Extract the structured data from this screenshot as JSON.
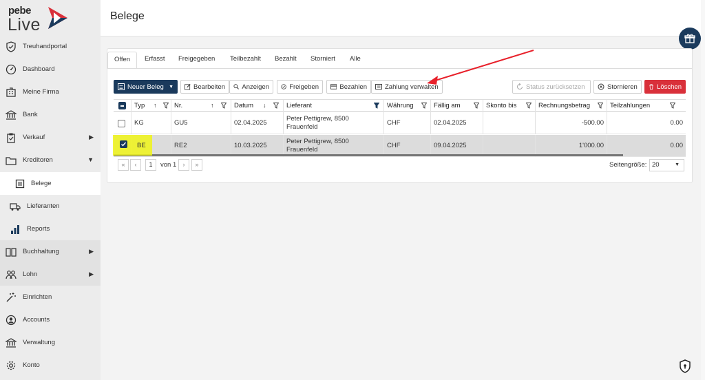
{
  "logo": {
    "brand_top": "pebe",
    "brand_bottom": "Live"
  },
  "sidebar": {
    "items": [
      {
        "label": "Treuhandportal",
        "icon": "shield-check-icon",
        "arrow": ""
      },
      {
        "label": "Dashboard",
        "icon": "gauge-icon",
        "arrow": ""
      },
      {
        "label": "Meine Firma",
        "icon": "building-icon",
        "arrow": ""
      },
      {
        "label": "Bank",
        "icon": "bank-icon",
        "arrow": ""
      },
      {
        "label": "Verkauf",
        "icon": "clipboard-check-icon",
        "arrow": "▶"
      },
      {
        "label": "Kreditoren",
        "icon": "folder-icon",
        "arrow": "▼"
      },
      {
        "label": "Belege",
        "icon": "receipt-icon",
        "arrow": ""
      },
      {
        "label": "Lieferanten",
        "icon": "truck-icon",
        "arrow": ""
      },
      {
        "label": "Reports",
        "icon": "bar-chart-icon",
        "arrow": ""
      },
      {
        "label": "Buchhaltung",
        "icon": "book-icon",
        "arrow": "▶"
      },
      {
        "label": "Lohn",
        "icon": "users-icon",
        "arrow": "▶"
      },
      {
        "label": "Einrichten",
        "icon": "magic-wand-icon",
        "arrow": ""
      },
      {
        "label": "Accounts",
        "icon": "user-circle-icon",
        "arrow": ""
      },
      {
        "label": "Verwaltung",
        "icon": "bank-icon",
        "arrow": ""
      },
      {
        "label": "Konto",
        "icon": "gear-icon",
        "arrow": ""
      }
    ]
  },
  "header": {
    "title": "Belege"
  },
  "tabs": [
    "Offen",
    "Erfasst",
    "Freigegeben",
    "Teilbezahlt",
    "Bezahlt",
    "Storniert",
    "Alle"
  ],
  "toolbar": {
    "new": "Neuer Beleg",
    "edit": "Bearbeiten",
    "show": "Anzeigen",
    "approve": "Freigeben",
    "pay": "Bezahlen",
    "manage_payment": "Zahlung verwalten",
    "reset_status": "Status zurücksetzen",
    "cancel": "Stornieren",
    "delete": "Löschen"
  },
  "table": {
    "columns": [
      "Typ",
      "Nr.",
      "Datum",
      "Lieferant",
      "Währung",
      "Fällig am",
      "Skonto bis",
      "Rechnungsbetrag",
      "Teilzahlungen"
    ],
    "rows": [
      {
        "typ": "KG",
        "nr": "GU5",
        "datum": "02.04.2025",
        "lieferant": "Peter Pettigrew, 8500 Frauenfeld",
        "waehrung": "CHF",
        "faellig": "02.04.2025",
        "skonto": "",
        "betrag": "-500.00",
        "teil": "0.00",
        "checked": false
      },
      {
        "typ": "BE",
        "nr": "RE2",
        "datum": "10.03.2025",
        "lieferant": "Peter Pettigrew, 8500 Frauenfeld",
        "waehrung": "CHF",
        "faellig": "09.04.2025",
        "skonto": "",
        "betrag": "1'000.00",
        "teil": "0.00",
        "checked": true
      }
    ]
  },
  "pager": {
    "page": "1",
    "of": "von 1",
    "size_label": "Seitengröße:",
    "size": "20"
  },
  "colors": {
    "primary": "#1a3a5c",
    "danger": "#d9303a",
    "highlight": "#f0f417",
    "arrow": "#e8202a"
  }
}
